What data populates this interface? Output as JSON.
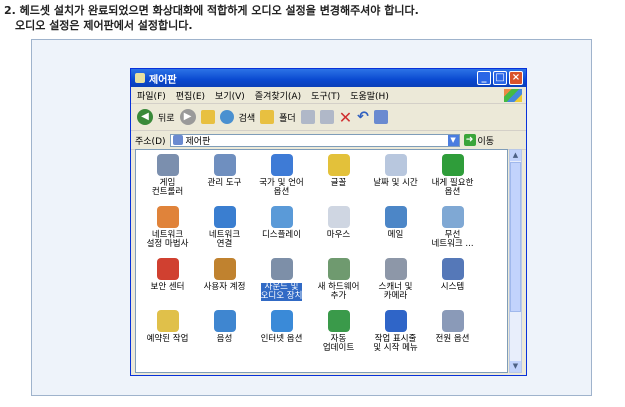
{
  "instructions": {
    "line1": "2. 헤드셋 설치가 완료되었으면 화상대화에 적합하게 오디오 설정을 변경해주셔야 합니다.",
    "line2": "오디오 설정은 제어판에서 설정합니다."
  },
  "window": {
    "title": "제어판",
    "menu": [
      "파일(F)",
      "편집(E)",
      "보기(V)",
      "즐겨찾기(A)",
      "도구(T)",
      "도움말(H)"
    ],
    "toolbar": {
      "back": "뒤로",
      "search": "검색",
      "folders": "폴더"
    },
    "address": {
      "label": "주소(D)",
      "value": "제어판",
      "go": "이동"
    },
    "items": [
      {
        "label": "게임\n컨트롤러",
        "color": "#7b8fae"
      },
      {
        "label": "관리 도구",
        "color": "#6f8fbf"
      },
      {
        "label": "국가 및 언어\n옵션",
        "color": "#3e7bd6"
      },
      {
        "label": "글꼴",
        "color": "#e3c13a"
      },
      {
        "label": "날짜 및 시간",
        "color": "#b8c7de"
      },
      {
        "label": "내게 필요한\n옵션",
        "color": "#2f9d3a"
      },
      {
        "label": "네트워크\n설정 마법사",
        "color": "#e0833a"
      },
      {
        "label": "네트워크\n연결",
        "color": "#3a7ed0"
      },
      {
        "label": "디스플레이",
        "color": "#5a9ad8"
      },
      {
        "label": "마우스",
        "color": "#cfd6e2"
      },
      {
        "label": "메일",
        "color": "#4c86c7"
      },
      {
        "label": "무선\n네트워크 ...",
        "color": "#7fa8d4"
      },
      {
        "label": "보안 센터",
        "color": "#d04030"
      },
      {
        "label": "사용자 계정",
        "color": "#c0822f"
      },
      {
        "label": "사운드 및\n오디오 장치",
        "color": "#7d8fa8",
        "selected": true
      },
      {
        "label": "새 하드웨어\n추가",
        "color": "#6f9a6f"
      },
      {
        "label": "스캐너 및\n카메라",
        "color": "#8d97a8"
      },
      {
        "label": "시스템",
        "color": "#5578b8"
      },
      {
        "label": "예약된 작업",
        "color": "#e0c04a"
      },
      {
        "label": "음성",
        "color": "#3f86d0"
      },
      {
        "label": "인터넷 옵션",
        "color": "#3a8ad8"
      },
      {
        "label": "자동\n업데이트",
        "color": "#3a9a4a"
      },
      {
        "label": "작업 표시줄\n및 시작 메뉴",
        "color": "#2f65c8"
      },
      {
        "label": "전원 옵션",
        "color": "#8a9ab8"
      }
    ]
  }
}
